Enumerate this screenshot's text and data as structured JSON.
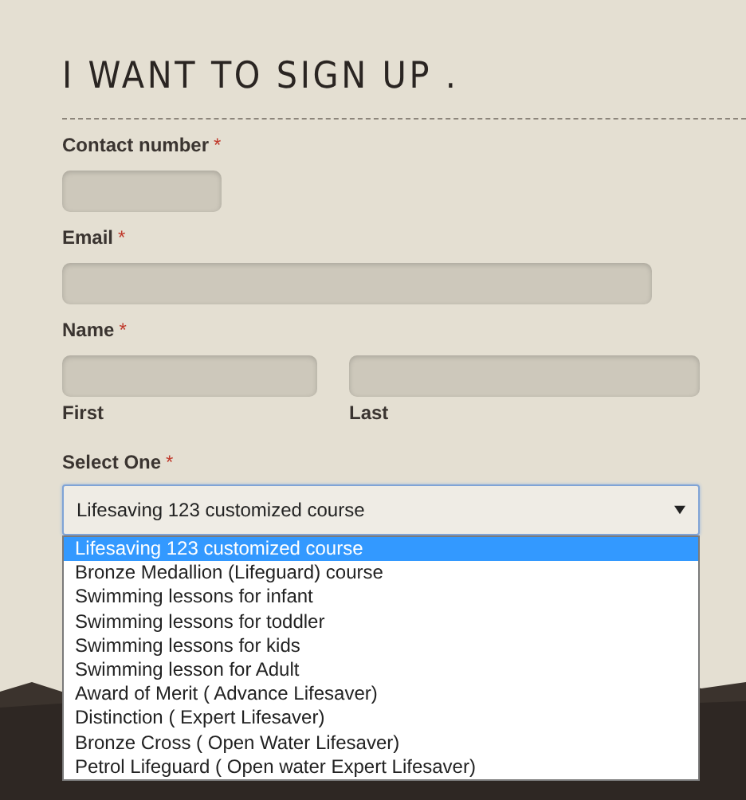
{
  "title": "I WANT TO SIGN UP .",
  "fields": [
    {
      "kind": "phone",
      "label": "Contact number",
      "required_mark": "*"
    },
    {
      "kind": "email",
      "label": "Email",
      "required_mark": "*"
    },
    {
      "kind": "name",
      "label": "Name",
      "required_mark": "*",
      "sublabels": [
        "First",
        "Last"
      ]
    },
    {
      "kind": "select",
      "label": "Select One",
      "required_mark": "*",
      "value": "Lifesaving 123 customized course",
      "expanded": true,
      "options": [
        {
          "label": "Lifesaving 123 customized course",
          "selected": true
        },
        {
          "label": "Bronze Medallion (Lifeguard) course",
          "selected": false
        },
        {
          "label": "Swimming lessons for infant",
          "selected": false
        },
        {
          "label": "Swimming lessons for toddler",
          "selected": false
        },
        {
          "label": "Swimming lessons for kids",
          "selected": false
        },
        {
          "label": "Swimming lesson for Adult",
          "selected": false
        },
        {
          "label": "Award of Merit ( Advance Lifesaver)",
          "selected": false
        },
        {
          "label": "Distinction ( Expert Lifesaver)",
          "selected": false
        },
        {
          "label": "Bronze Cross ( Open Water Lifesaver)",
          "selected": false
        },
        {
          "label": "Petrol Lifeguard ( Open water Expert Lifesaver)",
          "selected": false
        }
      ]
    }
  ]
}
